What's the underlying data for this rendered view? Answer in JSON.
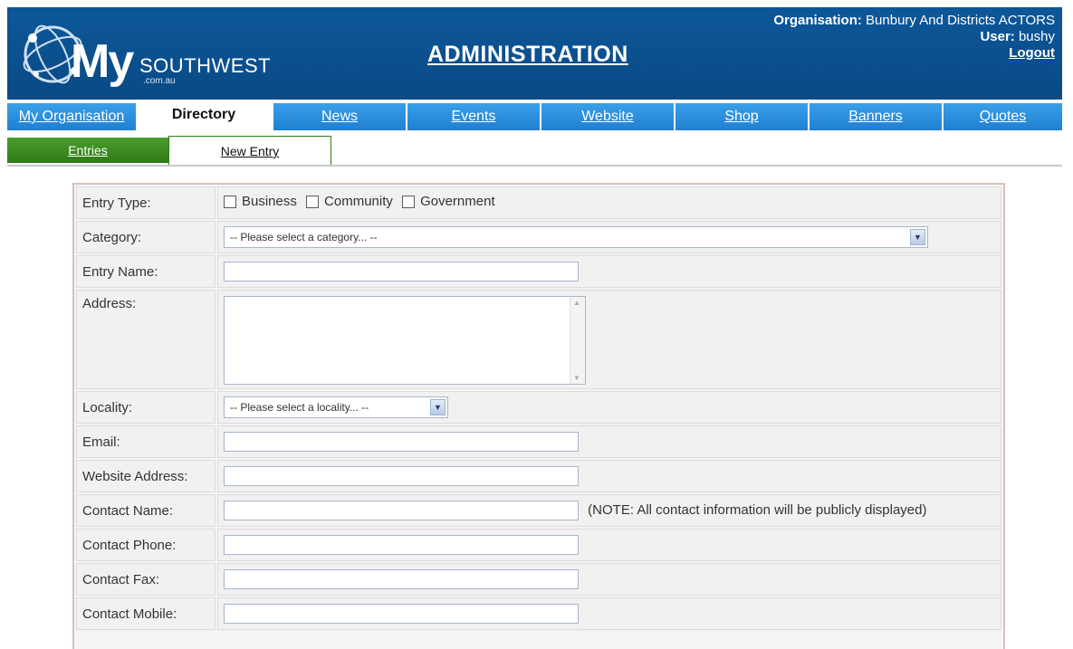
{
  "header": {
    "logo_my": "My",
    "logo_southwest": "SOUTHWEST",
    "logo_domain": ".com.au",
    "title": "ADMINISTRATION",
    "org_label": "Organisation:",
    "org_value": "Bunbury And Districts ACTORS",
    "user_label": "User:",
    "user_value": "bushy",
    "logout": "Logout"
  },
  "nav": {
    "tabs": [
      {
        "label": "My Organisation",
        "active": false
      },
      {
        "label": "Directory",
        "active": true
      },
      {
        "label": "News",
        "active": false
      },
      {
        "label": "Events",
        "active": false
      },
      {
        "label": "Website",
        "active": false
      },
      {
        "label": "Shop",
        "active": false
      },
      {
        "label": "Banners",
        "active": false
      },
      {
        "label": "Quotes",
        "active": false
      }
    ]
  },
  "subnav": {
    "entries": "Entries",
    "new_entry": "New Entry"
  },
  "form": {
    "entry_type_label": "Entry Type:",
    "entry_types": [
      "Business",
      "Community",
      "Government"
    ],
    "category_label": "Category:",
    "category_selected": "-- Please select a category... --",
    "entry_name_label": "Entry Name:",
    "address_label": "Address:",
    "locality_label": "Locality:",
    "locality_selected": "-- Please select a locality... --",
    "email_label": "Email:",
    "website_label": "Website Address:",
    "contact_name_label": "Contact Name:",
    "contact_note": "(NOTE: All contact information will be publicly displayed)",
    "contact_phone_label": "Contact Phone:",
    "contact_fax_label": "Contact Fax:",
    "contact_mobile_label": "Contact Mobile:"
  },
  "colors": {
    "header_bg": "#0b4f8d",
    "tab_blue": "#2a8de0",
    "sub_green": "#3d8c22"
  }
}
